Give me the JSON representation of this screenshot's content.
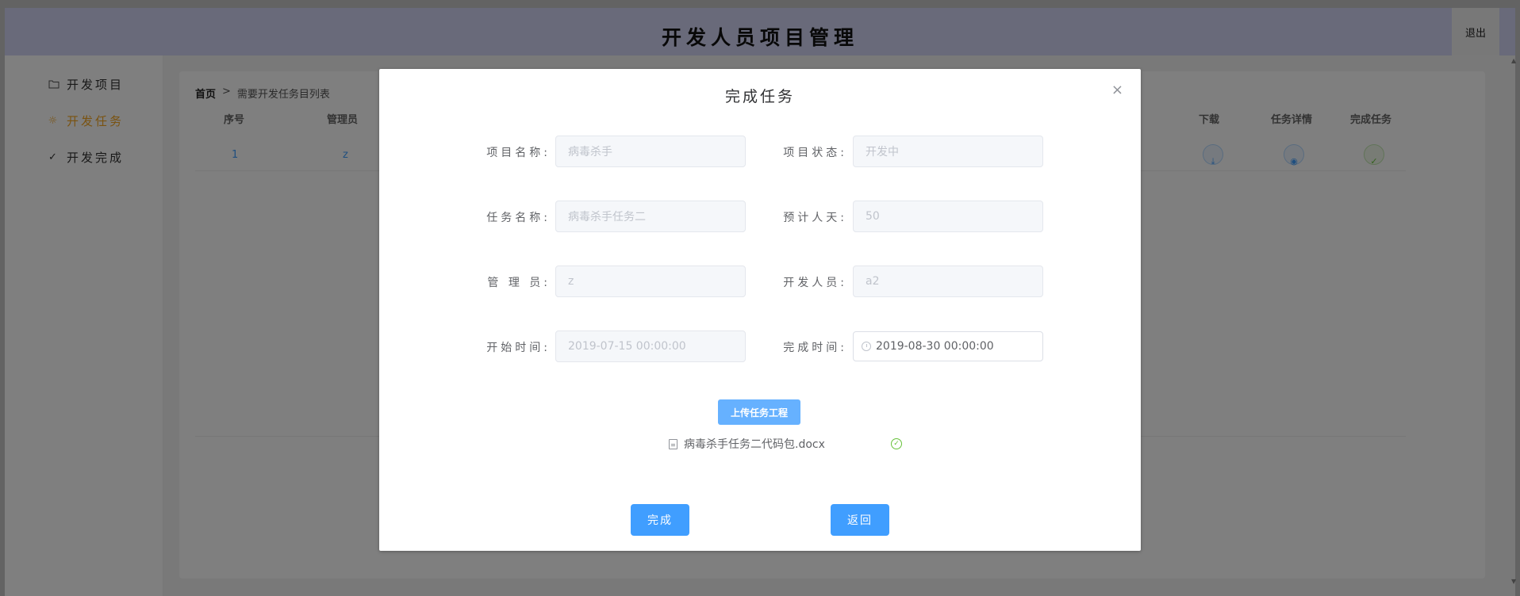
{
  "header": {
    "title": "开发人员项目管理",
    "logout_label": "退出"
  },
  "sidebar": {
    "items": [
      {
        "label": "开发项目",
        "icon": "folder-icon"
      },
      {
        "label": "开发任务",
        "icon": "sun-icon",
        "active": true
      },
      {
        "label": "开发完成",
        "icon": "check-icon"
      }
    ]
  },
  "breadcrumb": {
    "home": "首页",
    "separator": ">",
    "current": "需要开发任务目列表"
  },
  "table": {
    "columns": [
      "序号",
      "管理员",
      "下载",
      "任务详情",
      "完成任务"
    ],
    "rows": [
      {
        "index": "1",
        "manager": "z"
      }
    ]
  },
  "dialog": {
    "title": "完成任务",
    "close": "×",
    "fields": {
      "project_name": {
        "label": "项目名称:",
        "value": "病毒杀手"
      },
      "project_status": {
        "label": "项目状态:",
        "value": "开发中"
      },
      "task_name": {
        "label": "任务名称:",
        "value": "病毒杀手任务二"
      },
      "estimated_days": {
        "label": "预计人天:",
        "value": "50"
      },
      "manager": {
        "label": "管 理 员:",
        "value": "z"
      },
      "developer": {
        "label": "开发人员:",
        "value": "a2"
      },
      "start_time": {
        "label": "开始时间:",
        "value": "2019-07-15 00:00:00"
      },
      "end_time": {
        "label": "完成时间:",
        "value": "2019-08-30 00:00:00"
      }
    },
    "upload_label": "上传任务工程",
    "file_name": "病毒杀手任务二代码包.docx",
    "finish_label": "完成",
    "back_label": "返回"
  },
  "colors": {
    "primary": "#409eff",
    "active_menu": "#f5a623",
    "header_bg": "#d3d4f4"
  }
}
